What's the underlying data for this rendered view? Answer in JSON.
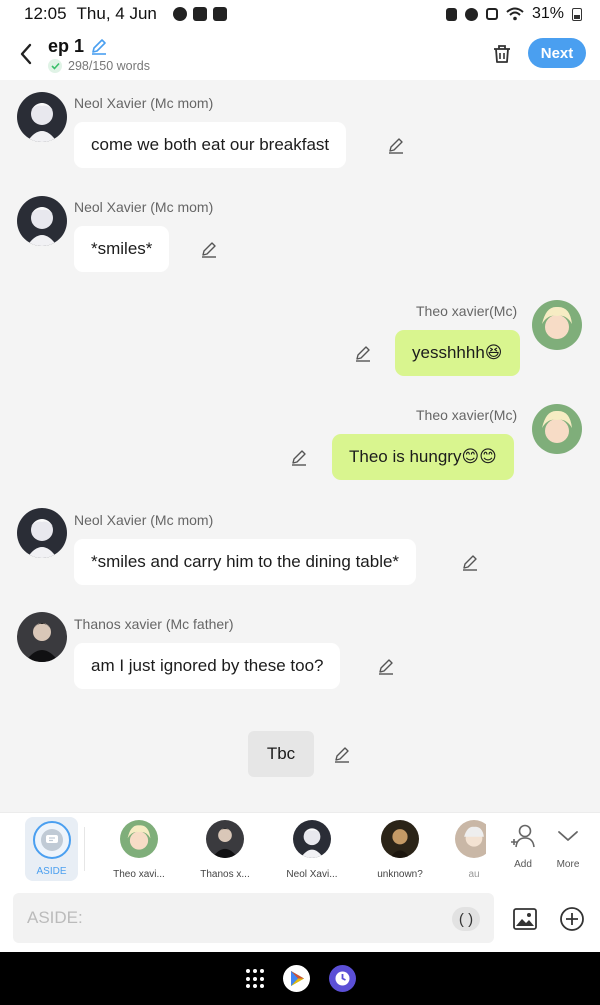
{
  "status_bar": {
    "time": "12:05",
    "date": "Thu, 4 Jun",
    "battery": "31%"
  },
  "header": {
    "title": "ep 1",
    "word_count": "298/150 words",
    "next_label": "Next"
  },
  "messages": [
    {
      "side": "left",
      "name": "Neol Xavier (Mc mom)",
      "text": "come we both eat our breakfast",
      "avatar": "neol"
    },
    {
      "side": "left",
      "name": "Neol Xavier (Mc mom)",
      "text": "*smiles*",
      "avatar": "neol"
    },
    {
      "side": "right",
      "name": "Theo xavier(Mc)",
      "text": "yesshhhh😆",
      "avatar": "theo"
    },
    {
      "side": "right",
      "name": "Theo xavier(Mc)",
      "text": "Theo is hungry😊😊",
      "avatar": "theo"
    },
    {
      "side": "left",
      "name": "Neol Xavier (Mc mom)",
      "text": "*smiles and carry him to the dining table*",
      "avatar": "neol"
    },
    {
      "side": "left",
      "name": "Thanos xavier (Mc father)",
      "text": "am I just ignored by these too?",
      "avatar": "thanos"
    },
    {
      "side": "center",
      "text": "Tbc"
    }
  ],
  "characters": {
    "aside_label": "ASIDE",
    "items": [
      {
        "label": "Theo xavi...",
        "avatar": "theo"
      },
      {
        "label": "Thanos x...",
        "avatar": "thanos"
      },
      {
        "label": "Neol Xavi...",
        "avatar": "neol"
      },
      {
        "label": "unknown?",
        "avatar": "unknown"
      },
      {
        "label": "au",
        "avatar": "au"
      }
    ],
    "add_label": "Add",
    "more_label": "More"
  },
  "input": {
    "placeholder": "ASIDE:",
    "paren_label": "( )"
  },
  "colors": {
    "accent": "#4a9ff0",
    "right_bubble": "#d9f58f",
    "left_bubble": "#ffffff",
    "background": "#f4f4f4"
  },
  "icons": [
    "back-arrow-icon",
    "pencil-icon",
    "check-icon",
    "trash-icon",
    "edit-icon",
    "chat-bubble-icon",
    "add-person-icon",
    "chevron-down-icon",
    "image-icon",
    "plus-circle-icon",
    "apps-grid-icon",
    "play-store-icon",
    "clock-app-icon"
  ]
}
